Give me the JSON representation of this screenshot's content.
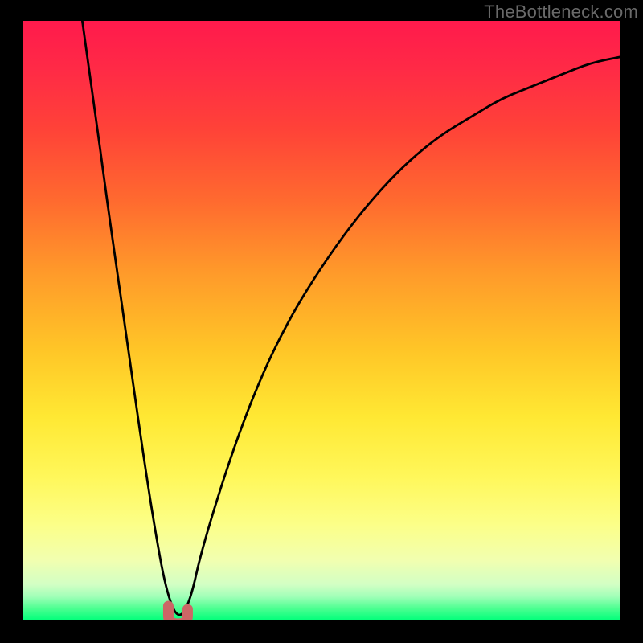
{
  "watermark": "TheBottleneck.com",
  "chart_data": {
    "type": "line",
    "title": "",
    "xlabel": "",
    "ylabel": "",
    "xlim": [
      0,
      100
    ],
    "ylim": [
      0,
      100
    ],
    "grid": false,
    "series": [
      {
        "name": "bottleneck-curve",
        "x": [
          10,
          12,
          14,
          16,
          18,
          20,
          22,
          24,
          26,
          28,
          30,
          35,
          40,
          45,
          50,
          55,
          60,
          65,
          70,
          75,
          80,
          85,
          90,
          95,
          100
        ],
        "values": [
          100,
          86,
          71,
          57,
          43,
          29,
          16,
          5,
          0,
          3,
          12,
          28,
          41,
          51,
          59,
          66,
          72,
          77,
          81,
          84,
          87,
          89,
          91,
          93,
          94
        ]
      }
    ],
    "annotations": [
      {
        "name": "threshold-marker",
        "x": 26,
        "y": 0
      }
    ],
    "background": {
      "type": "vertical-gradient",
      "stops": [
        {
          "pos": 0,
          "color": "#ff1a4c"
        },
        {
          "pos": 40,
          "color": "#ff9a2a"
        },
        {
          "pos": 70,
          "color": "#ffe833"
        },
        {
          "pos": 100,
          "color": "#00ff7a"
        }
      ]
    }
  }
}
